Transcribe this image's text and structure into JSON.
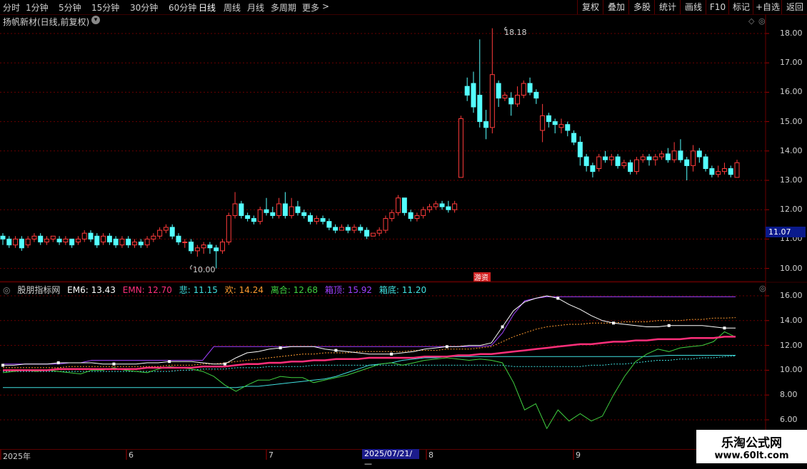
{
  "toolbar": {
    "periods": [
      "分时",
      "1分钟",
      "5分钟",
      "15分钟",
      "30分钟",
      "60分钟",
      "日线",
      "周线",
      "月线",
      "多周期",
      "更多"
    ],
    "active_period": "日线",
    "more_arrow": ">",
    "right_buttons": [
      "复权",
      "叠加",
      "多股",
      "统计",
      "画线",
      "F10",
      "+自选",
      "返回"
    ],
    "mark_label": "标记"
  },
  "chart": {
    "title": "扬帆新材(日线,前复权)",
    "title_icon": "chevron-down-icon",
    "high_label": "18.18",
    "low_label": "10.00",
    "last_price": "11.07",
    "event_tag": "游资",
    "y_ticks": [
      "18.00",
      "17.00",
      "16.00",
      "15.00",
      "14.00",
      "13.00",
      "12.00",
      "11.00",
      "10.00"
    ]
  },
  "indicator": {
    "name": "股朋指标网",
    "ema6": "EM6: 13.43",
    "emn": "EMN: 12.70",
    "bei": "悲: 11.15",
    "huan": "欢: 14.24",
    "lihe": "离合: 12.68",
    "xiangding": "箱顶: 15.92",
    "xiangdi": "箱底: 11.20",
    "y_ticks": [
      "16.00",
      "14.00",
      "12.00",
      "10.00",
      "8.00",
      "6.00"
    ]
  },
  "dates": {
    "labels": [
      "2025年",
      "6",
      "7",
      "8",
      "9"
    ],
    "cursor": "2025/07/21/—"
  },
  "watermark": {
    "line1": "乐淘公式网",
    "line2": "www.60lt.com"
  },
  "colors": {
    "up": "#ff3b3b",
    "down": "#54ffff",
    "grid": "#6a0000",
    "ema6": "#ffffff",
    "emn": "#ff2f7a",
    "bei": "#40e0e0",
    "huan": "#ff9a30",
    "lihe": "#40d040",
    "xiangding": "#a040ff",
    "xiangdi": "#40e0e0"
  },
  "candles": [
    [
      11.1,
      11.0,
      11.2,
      10.8
    ],
    [
      11.0,
      10.8,
      11.1,
      10.7
    ],
    [
      10.8,
      11.0,
      11.1,
      10.7
    ],
    [
      11.0,
      10.7,
      11.1,
      10.6
    ],
    [
      10.8,
      11.0,
      11.1,
      10.7
    ],
    [
      11.0,
      11.1,
      11.2,
      10.9
    ],
    [
      11.1,
      10.9,
      11.2,
      10.8
    ],
    [
      10.9,
      11.0,
      11.1,
      10.8
    ],
    [
      11.0,
      11.1,
      11.1,
      10.9
    ],
    [
      11.0,
      10.9,
      11.1,
      10.8
    ],
    [
      10.9,
      11.0,
      11.1,
      10.8
    ],
    [
      11.0,
      10.8,
      11.0,
      10.7
    ],
    [
      10.9,
      11.0,
      11.1,
      10.8
    ],
    [
      11.0,
      11.2,
      11.3,
      10.9
    ],
    [
      11.2,
      11.0,
      11.3,
      10.9
    ],
    [
      11.1,
      10.8,
      11.2,
      10.7
    ],
    [
      10.9,
      11.1,
      11.2,
      10.8
    ],
    [
      11.1,
      10.9,
      11.2,
      10.8
    ],
    [
      11.0,
      10.8,
      11.1,
      10.7
    ],
    [
      10.8,
      11.0,
      11.1,
      10.7
    ],
    [
      11.0,
      10.8,
      11.1,
      10.7
    ],
    [
      10.8,
      10.9,
      11.0,
      10.7
    ],
    [
      10.9,
      10.8,
      11.0,
      10.7
    ],
    [
      10.8,
      11.0,
      11.1,
      10.7
    ],
    [
      11.0,
      11.1,
      11.2,
      10.9
    ],
    [
      11.1,
      11.3,
      11.4,
      11.0
    ],
    [
      11.3,
      11.4,
      11.5,
      11.2
    ],
    [
      11.4,
      11.1,
      11.5,
      11.0
    ],
    [
      11.1,
      10.9,
      11.2,
      10.8
    ],
    [
      10.9,
      10.9,
      11.0,
      10.7
    ],
    [
      10.9,
      10.6,
      11.0,
      10.5
    ],
    [
      10.6,
      10.7,
      10.8,
      10.4
    ],
    [
      10.7,
      10.8,
      10.9,
      10.5
    ],
    [
      10.8,
      10.7,
      10.9,
      10.5
    ],
    [
      10.7,
      10.6,
      10.8,
      10.0
    ],
    [
      10.6,
      10.9,
      11.0,
      10.5
    ],
    [
      10.9,
      11.8,
      11.9,
      10.8
    ],
    [
      11.8,
      12.2,
      12.6,
      11.7
    ],
    [
      12.2,
      11.8,
      12.3,
      11.7
    ],
    [
      11.8,
      11.7,
      11.9,
      11.6
    ],
    [
      11.7,
      11.6,
      11.8,
      11.5
    ],
    [
      11.6,
      12.0,
      12.1,
      11.5
    ],
    [
      12.0,
      11.9,
      12.4,
      11.8
    ],
    [
      11.9,
      11.8,
      12.1,
      11.7
    ],
    [
      11.8,
      12.2,
      12.4,
      11.7
    ],
    [
      12.2,
      11.8,
      12.6,
      11.7
    ],
    [
      11.8,
      12.1,
      12.4,
      11.7
    ],
    [
      12.1,
      11.9,
      12.3,
      11.8
    ],
    [
      11.9,
      11.8,
      12.0,
      11.7
    ],
    [
      11.8,
      11.6,
      11.9,
      11.5
    ],
    [
      11.6,
      11.7,
      11.8,
      11.5
    ],
    [
      11.7,
      11.6,
      11.8,
      11.5
    ],
    [
      11.6,
      11.4,
      11.7,
      11.3
    ],
    [
      11.4,
      11.3,
      11.5,
      11.2
    ],
    [
      11.3,
      11.4,
      11.5,
      11.3
    ],
    [
      11.4,
      11.3,
      11.5,
      11.2
    ],
    [
      11.3,
      11.4,
      11.5,
      11.2
    ],
    [
      11.4,
      11.3,
      11.5,
      11.2
    ],
    [
      11.3,
      11.1,
      11.4,
      11.0
    ],
    [
      11.1,
      11.2,
      11.2,
      11.1
    ],
    [
      11.2,
      11.3,
      11.4,
      11.1
    ],
    [
      11.3,
      11.7,
      11.8,
      11.2
    ],
    [
      11.7,
      11.9,
      12.0,
      11.6
    ],
    [
      11.9,
      12.4,
      12.5,
      11.8
    ],
    [
      12.4,
      11.9,
      12.4,
      11.8
    ],
    [
      11.9,
      11.7,
      12.0,
      11.6
    ],
    [
      11.7,
      11.8,
      11.9,
      11.6
    ],
    [
      11.8,
      12.0,
      12.1,
      11.7
    ],
    [
      12.0,
      12.1,
      12.2,
      11.9
    ],
    [
      12.1,
      12.2,
      12.3,
      12.0
    ],
    [
      12.2,
      12.1,
      12.3,
      12.0
    ],
    [
      12.1,
      12.0,
      12.3,
      11.9
    ],
    [
      12.0,
      12.2,
      12.3,
      11.9
    ],
    [
      13.1,
      15.1,
      15.2,
      13.1
    ],
    [
      16.2,
      15.9,
      16.5,
      15.7
    ],
    [
      16.3,
      15.5,
      16.7,
      15.3
    ],
    [
      15.9,
      15.0,
      17.8,
      14.8
    ],
    [
      15.0,
      14.8,
      15.4,
      14.4
    ],
    [
      14.8,
      16.6,
      18.18,
      14.6
    ],
    [
      16.3,
      15.8,
      16.4,
      15.5
    ],
    [
      15.8,
      15.9,
      16.0,
      15.7
    ],
    [
      15.8,
      15.6,
      16.0,
      15.2
    ],
    [
      15.6,
      15.9,
      16.2,
      15.5
    ],
    [
      15.9,
      16.3,
      16.4,
      15.8
    ],
    [
      16.3,
      16.0,
      16.5,
      15.9
    ],
    [
      16.0,
      15.8,
      16.1,
      15.6
    ],
    [
      14.7,
      15.2,
      15.6,
      14.3
    ],
    [
      15.2,
      15.0,
      15.3,
      14.8
    ],
    [
      15.0,
      14.9,
      15.1,
      14.6
    ],
    [
      14.8,
      14.9,
      15.1,
      14.6
    ],
    [
      14.9,
      14.7,
      15.0,
      14.5
    ],
    [
      14.6,
      14.3,
      14.7,
      14.2
    ],
    [
      14.3,
      13.8,
      14.5,
      13.5
    ],
    [
      13.8,
      13.5,
      13.9,
      13.3
    ],
    [
      13.5,
      13.3,
      13.6,
      13.1
    ],
    [
      13.4,
      13.8,
      13.9,
      13.3
    ],
    [
      13.8,
      13.7,
      14.0,
      13.6
    ],
    [
      13.7,
      13.8,
      13.9,
      13.5
    ],
    [
      13.8,
      13.5,
      13.9,
      13.4
    ],
    [
      13.5,
      13.6,
      13.7,
      13.4
    ],
    [
      13.6,
      13.3,
      13.7,
      13.2
    ],
    [
      13.3,
      13.7,
      13.8,
      13.2
    ],
    [
      13.7,
      13.8,
      13.9,
      13.6
    ],
    [
      13.8,
      13.7,
      13.9,
      13.5
    ],
    [
      13.7,
      13.8,
      13.9,
      13.5
    ],
    [
      13.8,
      13.9,
      14.0,
      13.7
    ],
    [
      13.9,
      13.7,
      14.1,
      13.6
    ],
    [
      13.7,
      14.0,
      14.3,
      13.6
    ],
    [
      14.0,
      13.7,
      14.4,
      13.6
    ],
    [
      13.7,
      13.5,
      13.8,
      13.0
    ],
    [
      13.5,
      14.0,
      14.2,
      13.3
    ],
    [
      14.0,
      13.8,
      14.1,
      13.6
    ],
    [
      13.8,
      13.4,
      13.9,
      13.3
    ],
    [
      13.4,
      13.2,
      13.5,
      13.1
    ],
    [
      13.2,
      13.3,
      13.5,
      13.1
    ],
    [
      13.3,
      13.4,
      13.6,
      13.2
    ],
    [
      13.4,
      13.2,
      13.5,
      13.1
    ],
    [
      13.1,
      13.6,
      13.7,
      13.1
    ]
  ],
  "ind_series": {
    "ema6": [
      10.4,
      10.4,
      10.5,
      10.5,
      10.5,
      10.6,
      10.6,
      10.6,
      10.6,
      10.5,
      10.5,
      10.5,
      10.5,
      10.6,
      10.6,
      10.7,
      10.7,
      10.7,
      10.6,
      10.5,
      10.5,
      11.0,
      11.4,
      11.5,
      11.7,
      11.8,
      11.9,
      11.9,
      11.9,
      11.7,
      11.6,
      11.5,
      11.4,
      11.3,
      11.3,
      11.3,
      11.4,
      11.5,
      11.7,
      11.8,
      11.9,
      11.9,
      12.0,
      12.0,
      12.2,
      13.5,
      14.8,
      15.5,
      15.8,
      16.0,
      15.8,
      15.3,
      14.9,
      14.4,
      14.0,
      13.8,
      13.7,
      13.6,
      13.5,
      13.5,
      13.6,
      13.6,
      13.6,
      13.6,
      13.5,
      13.4,
      13.4
    ],
    "emn": [
      10.0,
      10.0,
      10.0,
      10.0,
      10.0,
      10.1,
      10.1,
      10.1,
      10.1,
      10.1,
      10.1,
      10.1,
      10.1,
      10.2,
      10.2,
      10.2,
      10.2,
      10.2,
      10.3,
      10.3,
      10.3,
      10.4,
      10.5,
      10.5,
      10.6,
      10.6,
      10.7,
      10.7,
      10.8,
      10.8,
      10.9,
      10.9,
      10.9,
      11.0,
      11.0,
      11.0,
      11.0,
      11.0,
      11.1,
      11.1,
      11.1,
      11.2,
      11.2,
      11.3,
      11.3,
      11.4,
      11.5,
      11.6,
      11.7,
      11.8,
      11.9,
      12.0,
      12.1,
      12.1,
      12.2,
      12.3,
      12.3,
      12.4,
      12.4,
      12.5,
      12.5,
      12.5,
      12.6,
      12.6,
      12.6,
      12.7,
      12.7
    ],
    "bei": [
      9.9,
      9.9,
      9.9,
      9.9,
      9.9,
      9.9,
      9.9,
      9.9,
      9.9,
      9.9,
      9.9,
      9.9,
      9.9,
      9.9,
      9.9,
      9.9,
      10.0,
      10.0,
      10.1,
      10.1,
      10.1,
      10.2,
      10.2,
      10.2,
      10.3,
      10.3,
      10.3,
      10.3,
      10.4,
      10.4,
      10.4,
      10.4,
      10.4,
      10.4,
      10.4,
      10.4,
      10.4,
      10.4,
      10.4,
      10.4,
      10.4,
      10.4,
      10.4,
      10.4,
      10.4,
      10.4,
      10.3,
      10.3,
      10.3,
      10.3,
      10.3,
      10.3,
      10.3,
      10.4,
      10.4,
      10.5,
      10.5,
      10.6,
      10.7,
      10.8,
      10.8,
      10.9,
      10.9,
      11.0,
      11.0,
      11.1,
      11.15
    ],
    "huan": [
      10.2,
      10.2,
      10.2,
      10.2,
      10.2,
      10.2,
      10.3,
      10.3,
      10.3,
      10.3,
      10.3,
      10.3,
      10.3,
      10.3,
      10.3,
      10.4,
      10.4,
      10.4,
      10.5,
      10.5,
      10.6,
      10.7,
      10.8,
      10.9,
      11.0,
      11.1,
      11.2,
      11.3,
      11.3,
      11.4,
      11.4,
      11.4,
      11.5,
      11.5,
      11.5,
      11.5,
      11.5,
      11.6,
      11.6,
      11.6,
      11.7,
      11.7,
      11.7,
      11.8,
      11.9,
      12.3,
      12.7,
      13.0,
      13.3,
      13.5,
      13.6,
      13.7,
      13.7,
      13.8,
      13.8,
      13.8,
      13.9,
      13.9,
      13.9,
      14.0,
      14.0,
      14.0,
      14.1,
      14.1,
      14.2,
      14.2,
      14.24
    ],
    "lihe": [
      9.8,
      9.9,
      10.0,
      9.9,
      10.0,
      9.9,
      9.8,
      9.7,
      10.0,
      10.0,
      10.2,
      10.0,
      9.9,
      9.8,
      10.1,
      10.3,
      10.2,
      10.1,
      9.9,
      9.5,
      8.8,
      8.3,
      8.8,
      9.2,
      9.2,
      9.5,
      9.4,
      9.4,
      9.0,
      9.2,
      9.4,
      9.6,
      9.9,
      10.2,
      10.5,
      10.6,
      10.4,
      10.6,
      10.8,
      10.9,
      11.0,
      10.9,
      10.8,
      10.9,
      10.8,
      10.6,
      9.0,
      6.8,
      7.3,
      5.3,
      6.8,
      5.9,
      6.5,
      5.9,
      6.3,
      8.0,
      9.5,
      10.7,
      11.3,
      11.7,
      11.5,
      11.8,
      11.9,
      12.0,
      12.3,
      13.1,
      12.68
    ],
    "xiangding": [
      10.5,
      10.5,
      10.5,
      10.5,
      10.5,
      10.5,
      10.6,
      10.6,
      10.8,
      10.8,
      10.8,
      10.8,
      10.8,
      10.8,
      10.8,
      10.8,
      10.8,
      10.8,
      10.8,
      11.9,
      11.9,
      11.9,
      11.9,
      11.9,
      11.9,
      11.9,
      11.9,
      11.9,
      11.9,
      11.9,
      11.9,
      11.9,
      11.9,
      11.9,
      11.9,
      11.9,
      11.9,
      11.9,
      11.9,
      11.9,
      11.9,
      11.9,
      11.9,
      11.9,
      12.0,
      13.0,
      14.5,
      15.6,
      15.8,
      15.92,
      15.92,
      15.92,
      15.92,
      15.92,
      15.92,
      15.92,
      15.92,
      15.92,
      15.92,
      15.92,
      15.92,
      15.92,
      15.92,
      15.92,
      15.92,
      15.92,
      15.92
    ],
    "xiangdi": [
      8.6,
      8.6,
      8.6,
      8.6,
      8.6,
      8.6,
      8.6,
      8.6,
      8.6,
      8.6,
      8.6,
      8.6,
      8.6,
      8.6,
      8.6,
      8.6,
      8.6,
      8.6,
      8.6,
      8.6,
      8.6,
      8.6,
      8.7,
      8.7,
      8.8,
      8.9,
      9.0,
      9.1,
      9.2,
      9.3,
      9.5,
      9.8,
      10.1,
      10.4,
      10.5,
      10.6,
      10.8,
      10.9,
      11.0,
      11.0,
      11.1,
      11.1,
      11.1,
      11.1,
      11.1,
      11.1,
      11.1,
      11.1,
      11.1,
      11.1,
      11.1,
      11.1,
      11.1,
      11.1,
      11.1,
      11.1,
      11.1,
      11.1,
      11.1,
      11.15,
      11.2,
      11.2,
      11.2,
      11.2,
      11.2,
      11.2,
      11.2
    ]
  }
}
